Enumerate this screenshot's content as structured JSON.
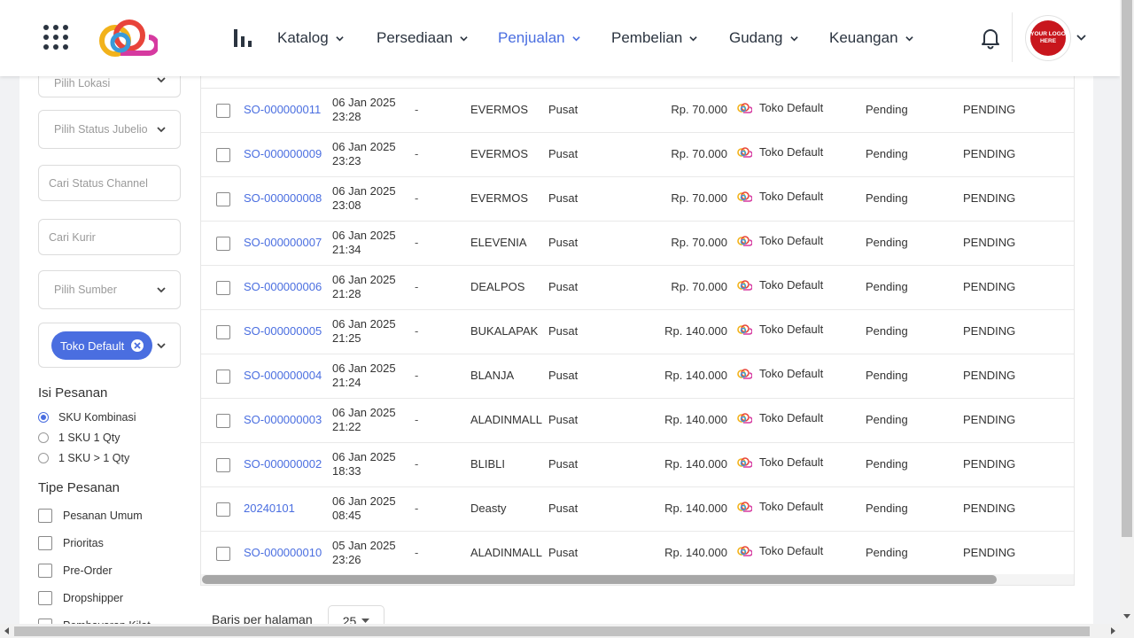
{
  "colors": {
    "accent": "#4a6ee0",
    "text": "#2b3440",
    "logo_red": "#c8161d"
  },
  "header": {
    "nav": [
      {
        "label": "Katalog"
      },
      {
        "label": "Persediaan"
      },
      {
        "label": "Penjualan",
        "active": true
      },
      {
        "label": "Pembelian"
      },
      {
        "label": "Gudang"
      },
      {
        "label": "Keuangan"
      }
    ],
    "avatar_text": "YOUR LOGO HERE"
  },
  "filters": {
    "lokasi_placeholder": "Pilih Lokasi",
    "jubelio_status_placeholder": "Pilih Status Jubelio",
    "channel_status_placeholder": "Cari Status Channel",
    "kurir_placeholder": "Cari Kurir",
    "sumber_placeholder": "Pilih Sumber",
    "store_tag": "Toko Default",
    "isi_pesanan_title": "Isi Pesanan",
    "isi_pesanan_options": [
      {
        "label": "SKU Kombinasi",
        "checked": true
      },
      {
        "label": "1 SKU 1 Qty",
        "checked": false
      },
      {
        "label": "1 SKU > 1 Qty",
        "checked": false
      }
    ],
    "tipe_pesanan_title": "Tipe Pesanan",
    "tipe_pesanan_options": [
      {
        "label": "Pesanan Umum"
      },
      {
        "label": "Prioritas"
      },
      {
        "label": "Pre-Order"
      },
      {
        "label": "Dropshipper"
      },
      {
        "label": "Pembayaran Kilat"
      }
    ]
  },
  "orders": [
    {
      "id": "SO-000000011",
      "date": "06 Jan 2025",
      "time": "23:28",
      "ref": "-",
      "channel": "EVERMOS",
      "location": "Pusat",
      "total": "Rp. 70.000",
      "store": "Toko Default",
      "status": "Pending",
      "channel_status": "PENDING"
    },
    {
      "id": "SO-000000009",
      "date": "06 Jan 2025",
      "time": "23:23",
      "ref": "-",
      "channel": "EVERMOS",
      "location": "Pusat",
      "total": "Rp. 70.000",
      "store": "Toko Default",
      "status": "Pending",
      "channel_status": "PENDING"
    },
    {
      "id": "SO-000000008",
      "date": "06 Jan 2025",
      "time": "23:08",
      "ref": "-",
      "channel": "EVERMOS",
      "location": "Pusat",
      "total": "Rp. 70.000",
      "store": "Toko Default",
      "status": "Pending",
      "channel_status": "PENDING"
    },
    {
      "id": "SO-000000007",
      "date": "06 Jan 2025",
      "time": "21:34",
      "ref": "-",
      "channel": "ELEVENIA",
      "location": "Pusat",
      "total": "Rp. 70.000",
      "store": "Toko Default",
      "status": "Pending",
      "channel_status": "PENDING"
    },
    {
      "id": "SO-000000006",
      "date": "06 Jan 2025",
      "time": "21:28",
      "ref": "-",
      "channel": "DEALPOS",
      "location": "Pusat",
      "total": "Rp. 70.000",
      "store": "Toko Default",
      "status": "Pending",
      "channel_status": "PENDING"
    },
    {
      "id": "SO-000000005",
      "date": "06 Jan 2025",
      "time": "21:25",
      "ref": "-",
      "channel": "BUKALAPAK",
      "location": "Pusat",
      "total": "Rp. 140.000",
      "store": "Toko Default",
      "status": "Pending",
      "channel_status": "PENDING"
    },
    {
      "id": "SO-000000004",
      "date": "06 Jan 2025",
      "time": "21:24",
      "ref": "-",
      "channel": "BLANJA",
      "location": "Pusat",
      "total": "Rp. 140.000",
      "store": "Toko Default",
      "status": "Pending",
      "channel_status": "PENDING"
    },
    {
      "id": "SO-000000003",
      "date": "06 Jan 2025",
      "time": "21:22",
      "ref": "-",
      "channel": "ALADINMALL",
      "location": "Pusat",
      "total": "Rp. 140.000",
      "store": "Toko Default",
      "status": "Pending",
      "channel_status": "PENDING"
    },
    {
      "id": "SO-000000002",
      "date": "06 Jan 2025",
      "time": "18:33",
      "ref": "-",
      "channel": "BLIBLI",
      "location": "Pusat",
      "total": "Rp. 140.000",
      "store": "Toko Default",
      "status": "Pending",
      "channel_status": "PENDING"
    },
    {
      "id": "20240101",
      "date": "06 Jan 2025",
      "time": "08:45",
      "ref": "-",
      "channel": "Deasty",
      "location": "Pusat",
      "total": "Rp. 140.000",
      "store": "Toko Default",
      "status": "Pending",
      "channel_status": "PENDING"
    },
    {
      "id": "SO-000000010",
      "date": "05 Jan 2025",
      "time": "23:26",
      "ref": "-",
      "channel": "ALADINMALL",
      "location": "Pusat",
      "total": "Rp. 140.000",
      "store": "Toko Default",
      "status": "Pending",
      "channel_status": "PENDING"
    }
  ],
  "pagination": {
    "rows_label": "Baris per halaman",
    "rows_value": "25"
  }
}
